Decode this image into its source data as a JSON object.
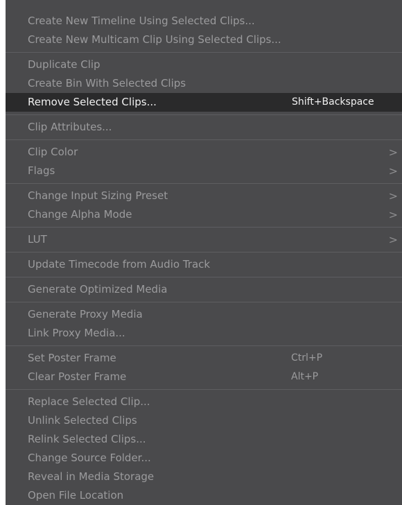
{
  "context_menu": {
    "groups": [
      [
        {
          "label": "Create New Timeline Using Selected Clips..."
        },
        {
          "label": "Create New Multicam Clip Using Selected Clips..."
        }
      ],
      [
        {
          "label": "Duplicate Clip"
        },
        {
          "label": "Create Bin With Selected Clips"
        },
        {
          "label": "Remove Selected Clips...",
          "shortcut": "Shift+Backspace",
          "highlighted": true
        }
      ],
      [
        {
          "label": "Clip Attributes..."
        }
      ],
      [
        {
          "label": "Clip Color",
          "submenu": true
        },
        {
          "label": "Flags",
          "submenu": true
        }
      ],
      [
        {
          "label": "Change Input Sizing Preset",
          "submenu": true
        },
        {
          "label": "Change Alpha Mode",
          "submenu": true
        }
      ],
      [
        {
          "label": "LUT",
          "submenu": true
        }
      ],
      [
        {
          "label": "Update Timecode from Audio Track"
        }
      ],
      [
        {
          "label": "Generate Optimized Media"
        }
      ],
      [
        {
          "label": "Generate Proxy Media"
        },
        {
          "label": "Link Proxy Media..."
        }
      ],
      [
        {
          "label": "Set Poster Frame",
          "shortcut": "Ctrl+P"
        },
        {
          "label": "Clear Poster Frame",
          "shortcut": "Alt+P"
        }
      ],
      [
        {
          "label": "Replace Selected Clip..."
        },
        {
          "label": "Unlink Selected Clips"
        },
        {
          "label": "Relink Selected Clips..."
        },
        {
          "label": "Change Source Folder..."
        },
        {
          "label": "Reveal in Media Storage"
        },
        {
          "label": "Open File Location"
        }
      ]
    ],
    "submenu_glyph": ">",
    "colors": {
      "menu_background": "#4a4a4c",
      "text": "#9b9b9d",
      "highlight_background": "#2a2a2b",
      "highlight_text": "#f1f1f1",
      "separator": "#5e5e61"
    }
  }
}
